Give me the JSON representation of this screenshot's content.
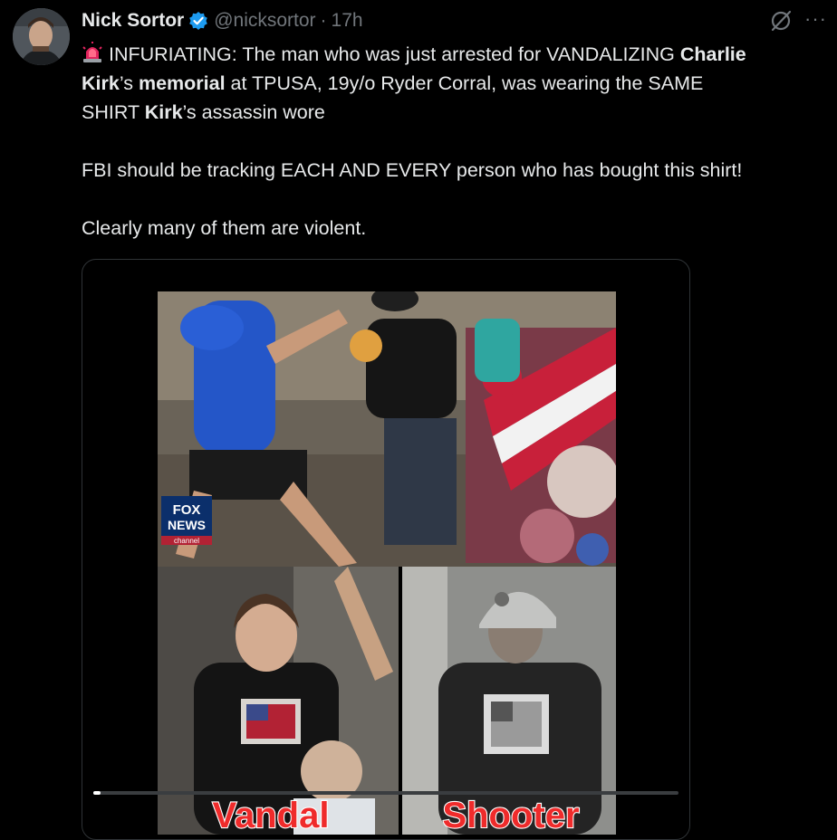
{
  "author": {
    "name": "Nick Sortor",
    "handle": "@nicksortor",
    "separator": "·",
    "time": "17h"
  },
  "icons": {
    "verified": "verified-badge-icon",
    "grok": "grok-icon",
    "more": "more-options-icon",
    "siren": "police-light-emoji"
  },
  "tweet": {
    "line1_prefix": "INFURIATING: The man who was just arrested for VANDALIZING ",
    "line1_bold": "Charlie",
    "line2_bold1": "Kirk",
    "line2_mid": "’s ",
    "line2_bold2": "memorial",
    "line2_rest": " at TPUSA, 19y/o Ryder Corral, was wearing the SAME",
    "line3_prefix": "SHIRT ",
    "line3_bold": "Kirk",
    "line3_rest": "’s assassin wore",
    "para2": "FBI should be tracking EACH AND EVERY person who has bought this shirt!",
    "para3": "Clearly many of them are violent."
  },
  "media": {
    "logo_line1": "FOX",
    "logo_line2": "NEWS",
    "logo_line3": "channel",
    "caption_left": "Vandal",
    "caption_right": "Shooter",
    "progress_fraction": 0.01
  },
  "colors": {
    "background": "#000000",
    "verified_blue": "#1d9bf0",
    "muted": "#71767b",
    "caption_red": "#ef2b2b"
  }
}
